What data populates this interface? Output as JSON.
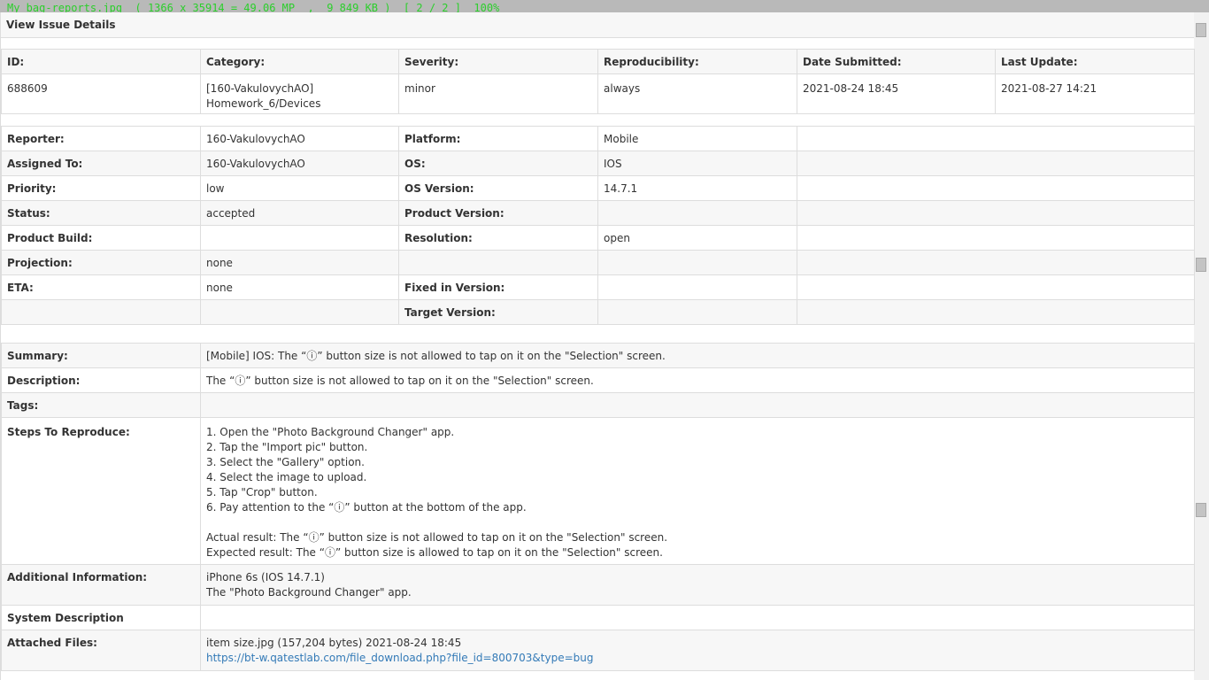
{
  "viewer": {
    "caption": "My bag-reports.jpg  ( 1366 x 35914 = 49.06 MP  ,  9 849 KB )  [ 2 / 2 ]  100%"
  },
  "header": {
    "title": "View Issue Details"
  },
  "summary_row": {
    "labels": [
      "ID:",
      "Category:",
      "Severity:",
      "Reproducibility:",
      "Date Submitted:",
      "Last Update:"
    ],
    "id": "688609",
    "category_line1": "[160-VakulovychAO]",
    "category_line2": "Homework_6/Devices",
    "severity": "minor",
    "reproducibility": "always",
    "date_submitted": "2021-08-24 18:45",
    "last_update": "2021-08-27 14:21"
  },
  "fields": {
    "reporter_label": "Reporter:",
    "reporter": "160-VakulovychAO",
    "platform_label": "Platform:",
    "platform": "Mobile",
    "assigned_label": "Assigned To:",
    "assigned": "160-VakulovychAO",
    "os_label": "OS:",
    "os": "IOS",
    "priority_label": "Priority:",
    "priority": "low",
    "os_version_label": "OS Version:",
    "os_version": "14.7.1",
    "status_label": "Status:",
    "status": "accepted",
    "product_version_label": "Product Version:",
    "product_version": "",
    "product_build_label": "Product Build:",
    "product_build": "",
    "resolution_label": "Resolution:",
    "resolution": "open",
    "projection_label": "Projection:",
    "projection": "none",
    "eta_label": "ETA:",
    "eta": "none",
    "fixed_in_label": "Fixed in Version:",
    "fixed_in": "",
    "target_label": "Target Version:",
    "target": ""
  },
  "details": {
    "summary_label": "Summary:",
    "summary": "[Mobile] IOS: The “ⓘ” button size is not allowed to tap on it on the \"Selection\" screen.",
    "description_label": "Description:",
    "description": "The “ⓘ” button size is not allowed to tap on it on the \"Selection\" screen.",
    "tags_label": "Tags:",
    "steps_label": "Steps To Reproduce:",
    "steps": [
      "1. Open the \"Photo Background Changer\" app.",
      "2. Tap the \"Import pic\" button.",
      "3. Select the \"Gallery\" option.",
      "4. Select the image to upload.",
      "5. Tap \"Crop\" button.",
      "6. Pay attention to the “ⓘ” button at the bottom of the app."
    ],
    "actual": "Actual result: The “ⓘ” button size is not allowed to tap on it on the \"Selection\" screen.",
    "expected": "Expected result: The “ⓘ” button size is allowed to tap on it on the \"Selection\" screen.",
    "additional_label": "Additional Information:",
    "additional_line1": "iPhone 6s (IOS 14.7.1)",
    "additional_line2": "The \"Photo Background Changer\" app.",
    "system_label": "System Description",
    "files_label": "Attached Files:",
    "file_info": "item size.jpg (157,204 bytes) 2021-08-24 18:45",
    "file_link": "https://bt-w.qatestlab.com/file_download.php?file_id=800703&type=bug"
  }
}
